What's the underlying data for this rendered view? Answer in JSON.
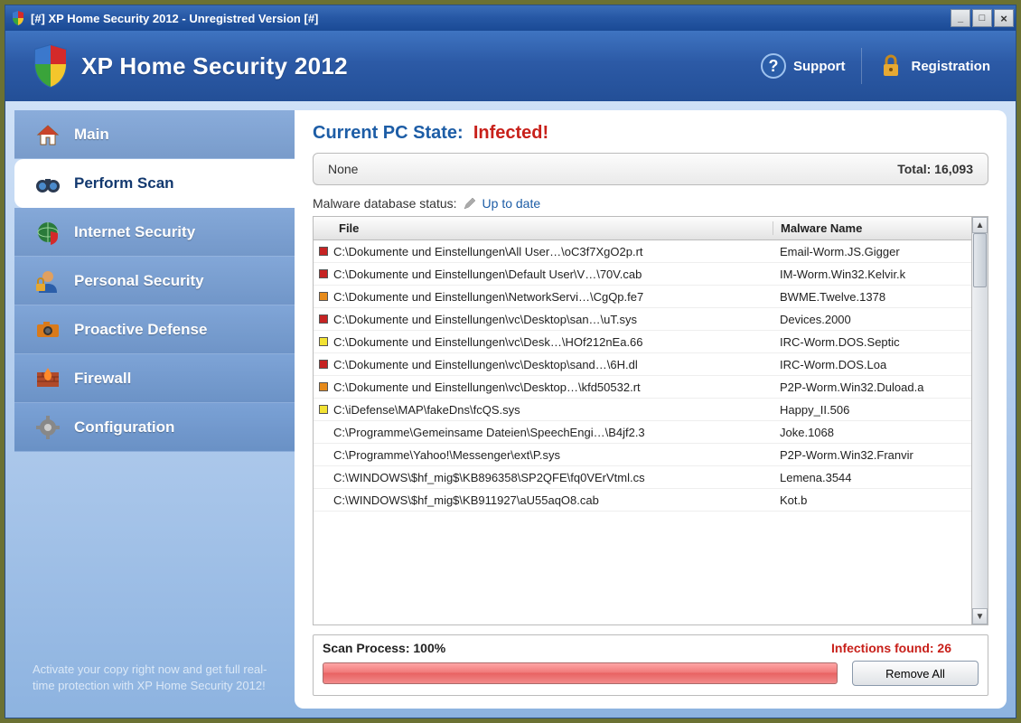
{
  "titlebar": {
    "text": "[#] XP Home Security 2012 - Unregistred Version [#]"
  },
  "header": {
    "app_title": "XP Home Security 2012",
    "support_label": "Support",
    "registration_label": "Registration"
  },
  "sidebar": {
    "items": [
      {
        "label": "Main",
        "icon": "home"
      },
      {
        "label": "Perform Scan",
        "icon": "binoculars",
        "active": true
      },
      {
        "label": "Internet Security",
        "icon": "globe"
      },
      {
        "label": "Personal Security",
        "icon": "user-lock"
      },
      {
        "label": "Proactive Defense",
        "icon": "camera"
      },
      {
        "label": "Firewall",
        "icon": "firewall"
      },
      {
        "label": "Configuration",
        "icon": "gear"
      }
    ],
    "promo": "Activate your copy right now and get full real-time protection with XP Home Security 2012!"
  },
  "main": {
    "state_label": "Current PC State:",
    "state_value": "Infected!",
    "summary_left": "None",
    "summary_total_label": "Total: 16,093",
    "db_label": "Malware database status:",
    "db_value": "Up to date",
    "col_file": "File",
    "col_malware": "Malware Name",
    "rows": [
      {
        "sev": "red",
        "file": "C:\\Dokumente und Einstellungen\\All User…\\oC3f7XgO2p.rt",
        "mal": "Email-Worm.JS.Gigger"
      },
      {
        "sev": "red",
        "file": "C:\\Dokumente und Einstellungen\\Default User\\V…\\70V.cab",
        "mal": "IM-Worm.Win32.Kelvir.k"
      },
      {
        "sev": "orange",
        "file": "C:\\Dokumente und Einstellungen\\NetworkServi…\\CgQp.fe7",
        "mal": "BWME.Twelve.1378"
      },
      {
        "sev": "red",
        "file": "C:\\Dokumente und Einstellungen\\vc\\Desktop\\san…\\uT.sys",
        "mal": "Devices.2000"
      },
      {
        "sev": "yellow",
        "file": "C:\\Dokumente und Einstellungen\\vc\\Desk…\\HOf212nEa.66",
        "mal": "IRC-Worm.DOS.Septic"
      },
      {
        "sev": "red",
        "file": "C:\\Dokumente und Einstellungen\\vc\\Desktop\\sand…\\6H.dl",
        "mal": "IRC-Worm.DOS.Loa"
      },
      {
        "sev": "orange",
        "file": "C:\\Dokumente und Einstellungen\\vc\\Desktop…\\kfd50532.rt",
        "mal": "P2P-Worm.Win32.Duload.a"
      },
      {
        "sev": "yellow",
        "file": "C:\\iDefense\\MAP\\fakeDns\\fcQS.sys",
        "mal": "Happy_II.506"
      },
      {
        "sev": "none",
        "file": "C:\\Programme\\Gemeinsame Dateien\\SpeechEngi…\\B4jf2.3",
        "mal": "Joke.1068"
      },
      {
        "sev": "none",
        "file": "C:\\Programme\\Yahoo!\\Messenger\\ext\\P.sys",
        "mal": "P2P-Worm.Win32.Franvir"
      },
      {
        "sev": "none",
        "file": "C:\\WINDOWS\\$hf_mig$\\KB896358\\SP2QFE\\fq0VErVtml.cs",
        "mal": "Lemena.3544"
      },
      {
        "sev": "none",
        "file": "C:\\WINDOWS\\$hf_mig$\\KB911927\\aU55aqO8.cab",
        "mal": "Kot.b"
      }
    ],
    "scan_process_label": "Scan Process: 100%",
    "infections_label": "Infections found: 26",
    "remove_label": "Remove All"
  }
}
